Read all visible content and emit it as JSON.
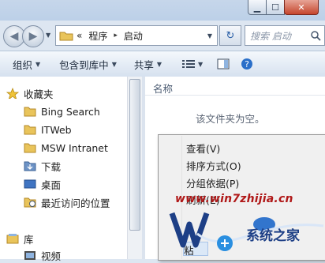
{
  "window": {
    "min_symbol": "▁",
    "max_symbol": "☐",
    "close_symbol": "✕"
  },
  "nav": {
    "back_symbol": "◀",
    "forward_symbol": "▶",
    "dropdown_symbol": "▼"
  },
  "address": {
    "prefix": "«",
    "parts": [
      "程序",
      "启动"
    ],
    "separator": "▸",
    "refresh_symbol": "↻"
  },
  "search": {
    "placeholder": "搜索 启动"
  },
  "toolbar": {
    "organize": "组织",
    "include": "包含到库中",
    "share": "共享",
    "arrow": "▼"
  },
  "navpane": {
    "favorites": "收藏夹",
    "items": [
      "Bing Search",
      "ITWeb",
      "MSW Intranet",
      "下载",
      "桌面",
      "最近访问的位置"
    ],
    "library": "库",
    "library_items": [
      "视频"
    ]
  },
  "content": {
    "column_name": "名称",
    "empty_message": "该文件夹为空。"
  },
  "context_menu": {
    "items": [
      "查看(V)",
      "排序方式(O)",
      "分组依据(P)",
      "刷新(E)"
    ],
    "partial_item": "粘"
  },
  "watermark": {
    "url": "www.win7zhijia.cn",
    "brand": "系统之家"
  },
  "colors": {
    "accent": "#2a5fa7",
    "watermark_red": "#b01818",
    "watermark_blue": "#1d3f86"
  }
}
